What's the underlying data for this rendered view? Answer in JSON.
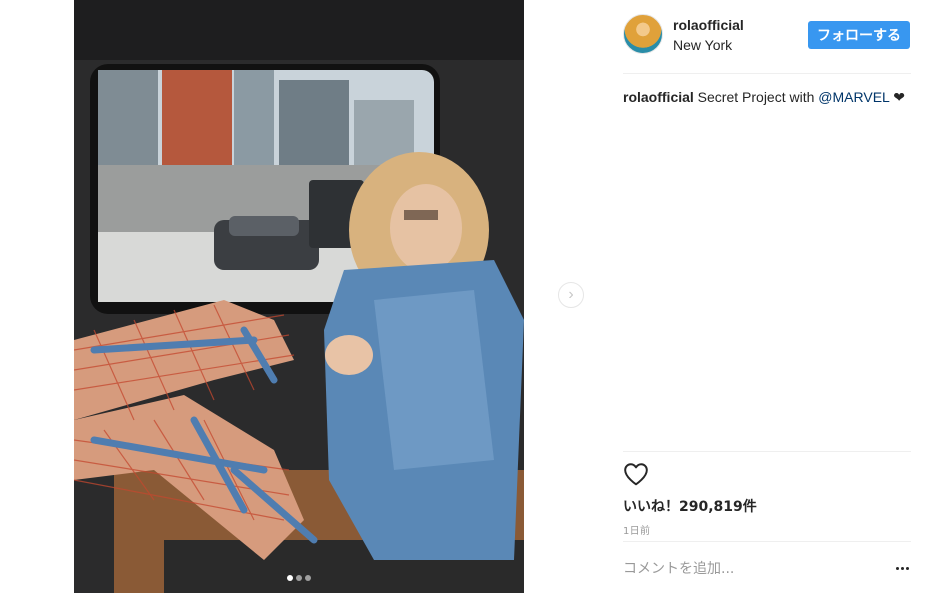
{
  "post": {
    "username": "rolaofficial",
    "location": "New York",
    "follow_label": "フォローする",
    "caption_user": "rolaofficial",
    "caption_text": " Secret Project with ",
    "caption_mention": "@MARVEL",
    "caption_emoji": " ❤",
    "likes_text": "いいね！290,819件",
    "timestamp": "1日前",
    "comment_placeholder": "コメントを追加...",
    "next_arrow": "›"
  },
  "carousel": {
    "count": 3,
    "active_index": 0
  },
  "colors": {
    "accent": "#3897f0",
    "mention": "#003569",
    "divider": "#efefef",
    "muted": "#999999"
  },
  "icons": [
    "heart-icon",
    "chevron-right-icon",
    "more-options-icon",
    "avatar"
  ]
}
